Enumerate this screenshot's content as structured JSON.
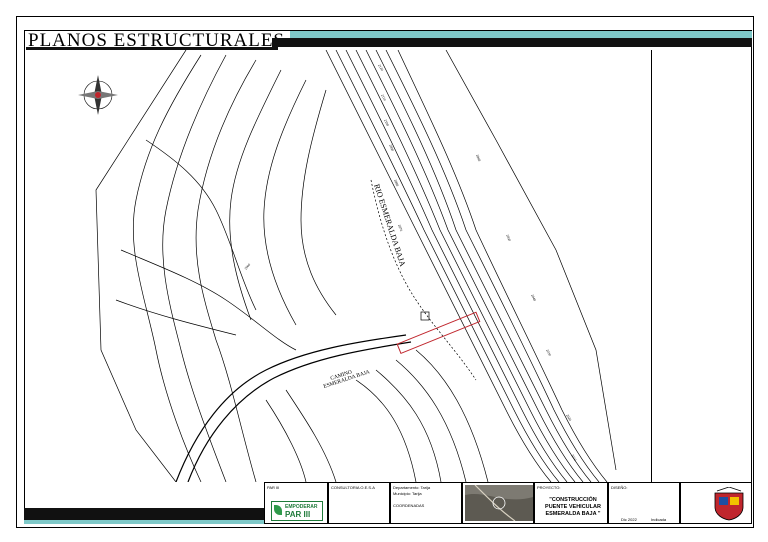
{
  "sheet": {
    "title": "PLANOS ESTRUCTURALES",
    "colors": {
      "teal": "#7fc9c9",
      "black": "#111111",
      "green": "#1f7a3a",
      "red": "#c0262d"
    }
  },
  "map": {
    "north_symbol": "north-arrow-compass",
    "river_label": "RIO ESMERALDA BAJA",
    "road_label": "CAMINO ESMERALDA BAJA",
    "road_label_line1": "CAMINO",
    "road_label_line2": "ESMERALDA BAJA",
    "contour_labels": [
      "2120",
      "2110",
      "2100",
      "2090",
      "2080",
      "2070",
      "2060",
      "2050",
      "2040",
      "2030",
      "2020",
      "2010",
      "2000"
    ]
  },
  "title_block": {
    "col1_top": "PAR III",
    "col2_top": "CONSULTORIA O.E.S.A",
    "location_label1": "Departamento: Tarija",
    "location_label2": "Municipio: Tarija",
    "coords_label": "COORDENADAS",
    "project_label": "PROYECTO:",
    "project_name": "\"CONSTRUCCIÓN PUENTE VEHICULAR ESMERALDA BAJA \"",
    "drawing_label": "DISEÑO:",
    "date_value": "Dic 2022",
    "scale_value": "Indicada",
    "logo_text1": "EMPODERAR",
    "logo_text2": "PAR III"
  }
}
